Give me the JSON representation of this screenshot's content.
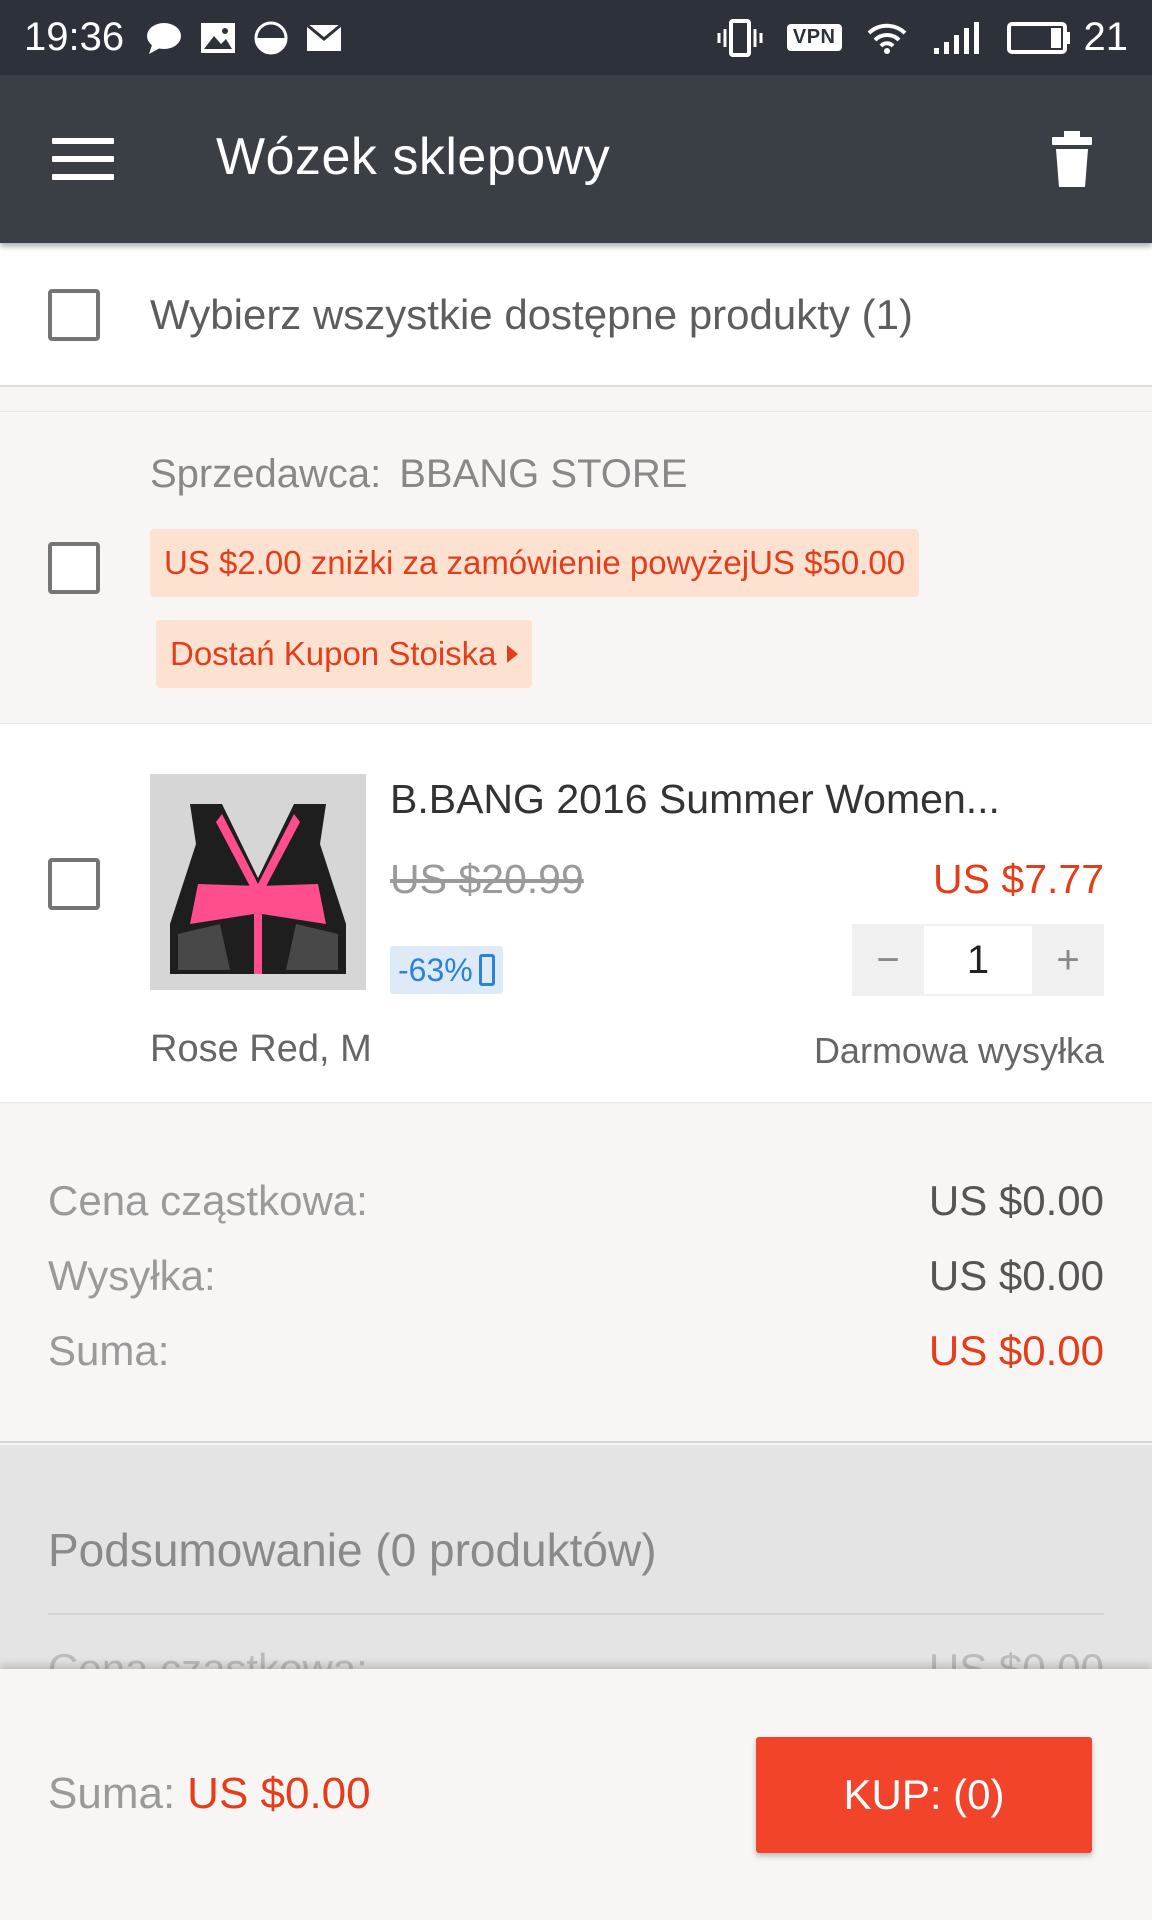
{
  "status_bar": {
    "time": "19:36",
    "vpn_label": "VPN",
    "battery_level": "21",
    "icons": [
      "chat-icon",
      "image-icon",
      "data-saver-icon",
      "mail-icon",
      "vibrate-icon",
      "vpn-icon",
      "wifi-icon",
      "signal-icon",
      "battery-icon"
    ]
  },
  "app_bar": {
    "title": "Wózek sklepowy",
    "menu_icon": "menu-icon",
    "delete_icon": "trash-icon"
  },
  "select_all": {
    "label": "Wybierz wszystkie dostępne produkty (1)",
    "checked": false
  },
  "seller": {
    "label": "Sprzedawca:",
    "name": "BBANG STORE",
    "promo": "US $2.00 zniżki za zamówienie powyżejUS $50.00",
    "coupon_button": "Dostań Kupon Stoiska",
    "checked": false
  },
  "product": {
    "title": "B.BANG 2016 Summer Women...",
    "old_price": "US $20.99",
    "price": "US $7.77",
    "discount": "-63%",
    "quantity": "1",
    "variant": "Rose Red, M",
    "shipping": "Darmowa wysyłka",
    "checked": false
  },
  "totals": {
    "subtotal_label": "Cena cząstkowa:",
    "subtotal_value": "US $0.00",
    "shipping_label": "Wysyłka:",
    "shipping_value": "US $0.00",
    "sum_label": "Suma:",
    "sum_value": "US $0.00"
  },
  "summary": {
    "title": "Podsumowanie (0 produktów)",
    "row_label": "Cena cząstkowa:",
    "row_value": "US $0.00"
  },
  "bottom_bar": {
    "sum_label": "Suma:",
    "sum_value": "US $0.00",
    "buy_label": "KUP: (0)"
  },
  "colors": {
    "app_bar": "#3a3f46",
    "accent_red": "#e53d19",
    "buy_button": "#f2442b",
    "discount_blue": "#2b82d9"
  }
}
